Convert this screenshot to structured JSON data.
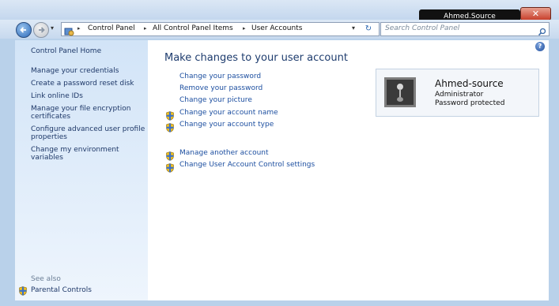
{
  "window": {
    "title": "Ahmed.Source",
    "close_label": "✕"
  },
  "address_bar": {
    "breadcrumbs": [
      "Control Panel",
      "All Control Panel Items",
      "User Accounts"
    ],
    "separator": "▸",
    "search_placeholder": "Search Control Panel"
  },
  "sidebar": {
    "home_link": "Control Panel Home",
    "items": [
      "Manage your credentials",
      "Create a password reset disk",
      "Link online IDs",
      "Manage your file encryption certificates",
      "Configure advanced user profile properties",
      "Change my environment variables"
    ],
    "see_also_label": "See also",
    "see_also_items": [
      "Parental Controls"
    ]
  },
  "main": {
    "title": "Make changes to your user account",
    "tasks": [
      {
        "label": "Change your password",
        "icon": "none"
      },
      {
        "label": "Remove your password",
        "icon": "none"
      },
      {
        "label": "Change your picture",
        "icon": "none"
      },
      {
        "label": "Change your account name",
        "icon": "shield-icon"
      },
      {
        "label": "Change your account type",
        "icon": "shield-icon"
      }
    ],
    "other_tasks": [
      {
        "label": "Manage another account",
        "icon": "shield-icon"
      },
      {
        "label": "Change User Account Control settings",
        "icon": "shield-icon"
      }
    ],
    "help_label": "?"
  },
  "account": {
    "name": "Ahmed-source",
    "role": "Administrator",
    "status": "Password protected",
    "picture_icon": "guitar-picture"
  },
  "colors": {
    "sidebar_link": "#1e3868",
    "task_link": "#1d4fa0",
    "title": "#1e3c6e",
    "close_button": "#c8402c"
  }
}
